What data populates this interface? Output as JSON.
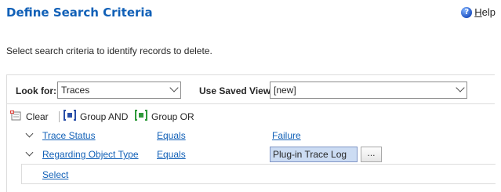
{
  "header": {
    "title": "Define Search Criteria",
    "help_prefix": "H",
    "help_rest": "elp"
  },
  "instructions": "Select search criteria to identify records to delete.",
  "look_for": {
    "label": "Look for:",
    "value": "Traces"
  },
  "saved_view": {
    "label": "Use Saved View:",
    "value": "[new]"
  },
  "toolbar": {
    "clear_label": "Clear",
    "group_and_label": "Group AND",
    "group_or_label": "Group OR"
  },
  "conditions": [
    {
      "field": "Trace Status",
      "operator": "Equals",
      "value": "Failure"
    },
    {
      "field": "Regarding Object Type",
      "operator": "Equals",
      "value": "Plug-in Trace Log",
      "lookup_label": "..."
    }
  ],
  "select_link": "Select"
}
